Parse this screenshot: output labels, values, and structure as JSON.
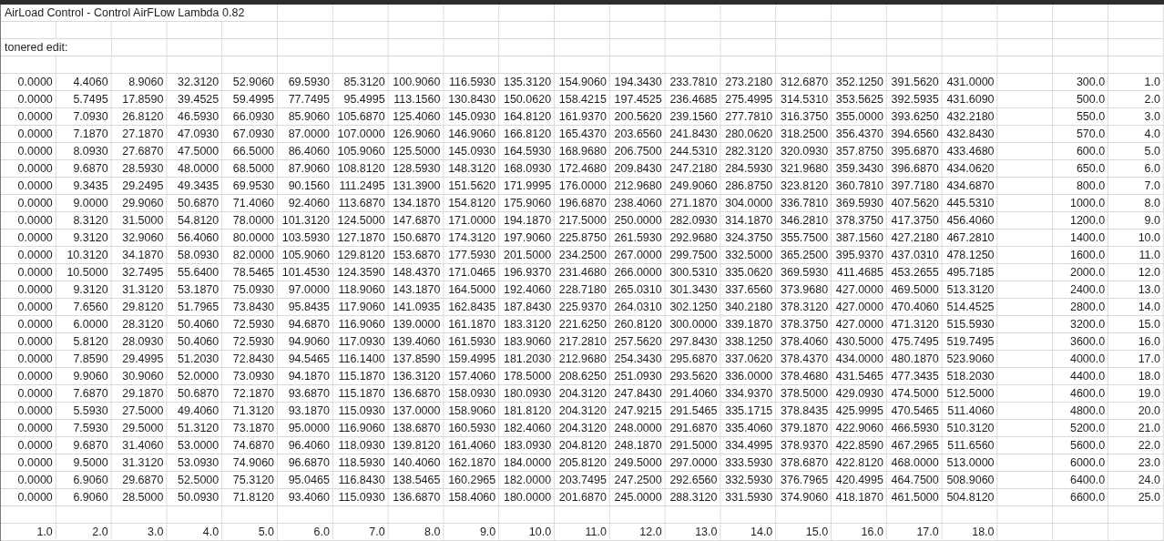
{
  "sheet": {
    "title": "AirLoad Control - Control AirFLow Lambda 0.82",
    "note": "tonered edit:",
    "rows": [
      {
        "values": [
          "0.0000",
          "4.4060",
          "8.9060",
          "32.3120",
          "52.9060",
          "69.5930",
          "85.3120",
          "100.9060",
          "116.5930",
          "135.3120",
          "154.9060",
          "194.3430",
          "233.7810",
          "273.2180",
          "312.6870",
          "352.1250",
          "391.5620",
          "431.0000"
        ],
        "rpm": "300.0",
        "index": "1.0"
      },
      {
        "values": [
          "0.0000",
          "5.7495",
          "17.8590",
          "39.4525",
          "59.4995",
          "77.7495",
          "95.4995",
          "113.1560",
          "130.8430",
          "150.0620",
          "158.4215",
          "197.4525",
          "236.4685",
          "275.4995",
          "314.5310",
          "353.5625",
          "392.5935",
          "431.6090"
        ],
        "rpm": "500.0",
        "index": "2.0"
      },
      {
        "values": [
          "0.0000",
          "7.0930",
          "26.8120",
          "46.5930",
          "66.0930",
          "85.9060",
          "105.6870",
          "125.4060",
          "145.0930",
          "164.8120",
          "161.9370",
          "200.5620",
          "239.1560",
          "277.7810",
          "316.3750",
          "355.0000",
          "393.6250",
          "432.2180"
        ],
        "rpm": "550.0",
        "index": "3.0"
      },
      {
        "values": [
          "0.0000",
          "7.1870",
          "27.1870",
          "47.0930",
          "67.0930",
          "87.0000",
          "107.0000",
          "126.9060",
          "146.9060",
          "166.8120",
          "165.4370",
          "203.6560",
          "241.8430",
          "280.0620",
          "318.2500",
          "356.4370",
          "394.6560",
          "432.8430"
        ],
        "rpm": "570.0",
        "index": "4.0"
      },
      {
        "values": [
          "0.0000",
          "8.0930",
          "27.6870",
          "47.5000",
          "66.5000",
          "86.4060",
          "105.9060",
          "125.5000",
          "145.0930",
          "164.5930",
          "168.9680",
          "206.7500",
          "244.5310",
          "282.3120",
          "320.0930",
          "357.8750",
          "395.6870",
          "433.4680"
        ],
        "rpm": "600.0",
        "index": "5.0"
      },
      {
        "values": [
          "0.0000",
          "9.6870",
          "28.5930",
          "48.0000",
          "68.5000",
          "87.9060",
          "108.8120",
          "128.5930",
          "148.3120",
          "168.0930",
          "172.4680",
          "209.8430",
          "247.2180",
          "284.5930",
          "321.9680",
          "359.3430",
          "396.6870",
          "434.0620"
        ],
        "rpm": "650.0",
        "index": "6.0"
      },
      {
        "values": [
          "0.0000",
          "9.3435",
          "29.2495",
          "49.3435",
          "69.9530",
          "90.1560",
          "111.2495",
          "131.3900",
          "151.5620",
          "171.9995",
          "176.0000",
          "212.9680",
          "249.9060",
          "286.8750",
          "323.8120",
          "360.7810",
          "397.7180",
          "434.6870"
        ],
        "rpm": "800.0",
        "index": "7.0"
      },
      {
        "values": [
          "0.0000",
          "9.0000",
          "29.9060",
          "50.6870",
          "71.4060",
          "92.4060",
          "113.6870",
          "134.1870",
          "154.8120",
          "175.9060",
          "196.6870",
          "238.4060",
          "271.1870",
          "304.0000",
          "336.7810",
          "369.5930",
          "407.5620",
          "445.5310"
        ],
        "rpm": "1000.0",
        "index": "8.0"
      },
      {
        "values": [
          "0.0000",
          "8.3120",
          "31.5000",
          "54.8120",
          "78.0000",
          "101.3120",
          "124.5000",
          "147.6870",
          "171.0000",
          "194.1870",
          "217.5000",
          "250.0000",
          "282.0930",
          "314.1870",
          "346.2810",
          "378.3750",
          "417.3750",
          "456.4060"
        ],
        "rpm": "1200.0",
        "index": "9.0"
      },
      {
        "values": [
          "0.0000",
          "9.3120",
          "32.9060",
          "56.4060",
          "80.0000",
          "103.5930",
          "127.1870",
          "150.6870",
          "174.3120",
          "197.9060",
          "225.8750",
          "261.5930",
          "292.9680",
          "324.3750",
          "355.7500",
          "387.1560",
          "427.2180",
          "467.2810"
        ],
        "rpm": "1400.0",
        "index": "10.0"
      },
      {
        "values": [
          "0.0000",
          "10.3120",
          "34.1870",
          "58.0930",
          "82.0000",
          "105.9060",
          "129.8120",
          "153.6870",
          "177.5930",
          "201.5000",
          "234.2500",
          "267.0000",
          "299.7500",
          "332.5000",
          "365.2500",
          "395.9370",
          "437.0310",
          "478.1250"
        ],
        "rpm": "1600.0",
        "index": "11.0"
      },
      {
        "values": [
          "0.0000",
          "10.5000",
          "32.7495",
          "55.6400",
          "78.5465",
          "101.4530",
          "124.3590",
          "148.4370",
          "171.0465",
          "196.9370",
          "231.4680",
          "266.0000",
          "300.5310",
          "335.0620",
          "369.5930",
          "411.4685",
          "453.2655",
          "495.7185"
        ],
        "rpm": "2000.0",
        "index": "12.0"
      },
      {
        "values": [
          "0.0000",
          "9.3120",
          "31.3120",
          "53.1870",
          "75.0930",
          "97.0000",
          "118.9060",
          "143.1870",
          "164.5000",
          "192.4060",
          "228.7180",
          "265.0310",
          "301.3430",
          "337.6560",
          "373.9680",
          "427.0000",
          "469.5000",
          "513.3120"
        ],
        "rpm": "2400.0",
        "index": "13.0"
      },
      {
        "values": [
          "0.0000",
          "7.6560",
          "29.8120",
          "51.7965",
          "73.8430",
          "95.8435",
          "117.9060",
          "141.0935",
          "162.8435",
          "187.8430",
          "225.9370",
          "264.0310",
          "302.1250",
          "340.2180",
          "378.3120",
          "427.0000",
          "470.4060",
          "514.4525"
        ],
        "rpm": "2800.0",
        "index": "14.0"
      },
      {
        "values": [
          "0.0000",
          "6.0000",
          "28.3120",
          "50.4060",
          "72.5930",
          "94.6870",
          "116.9060",
          "139.0000",
          "161.1870",
          "183.3120",
          "221.6250",
          "260.8120",
          "300.0000",
          "339.1870",
          "378.3750",
          "427.0000",
          "471.3120",
          "515.5930"
        ],
        "rpm": "3200.0",
        "index": "15.0"
      },
      {
        "values": [
          "0.0000",
          "5.8120",
          "28.0930",
          "50.4060",
          "72.5930",
          "94.9060",
          "117.0930",
          "139.4060",
          "161.5930",
          "183.9060",
          "217.2810",
          "257.5620",
          "297.8430",
          "338.1250",
          "378.4060",
          "430.5000",
          "475.7495",
          "519.7495"
        ],
        "rpm": "3600.0",
        "index": "16.0"
      },
      {
        "values": [
          "0.0000",
          "7.8590",
          "29.4995",
          "51.2030",
          "72.8430",
          "94.5465",
          "116.1400",
          "137.8590",
          "159.4995",
          "181.2030",
          "212.9680",
          "254.3430",
          "295.6870",
          "337.0620",
          "378.4370",
          "434.0000",
          "480.1870",
          "523.9060"
        ],
        "rpm": "4000.0",
        "index": "17.0"
      },
      {
        "values": [
          "0.0000",
          "9.9060",
          "30.9060",
          "52.0000",
          "73.0930",
          "94.1870",
          "115.1870",
          "136.3120",
          "157.4060",
          "178.5000",
          "208.6250",
          "251.0930",
          "293.5620",
          "336.0000",
          "378.4680",
          "431.5465",
          "477.3435",
          "518.2030"
        ],
        "rpm": "4400.0",
        "index": "18.0"
      },
      {
        "values": [
          "0.0000",
          "7.6870",
          "29.1870",
          "50.6870",
          "72.1870",
          "93.6870",
          "115.1870",
          "136.6870",
          "158.0930",
          "180.0930",
          "204.3120",
          "247.8430",
          "291.4060",
          "334.9370",
          "378.5000",
          "429.0930",
          "474.5000",
          "512.5000"
        ],
        "rpm": "4600.0",
        "index": "19.0"
      },
      {
        "values": [
          "0.0000",
          "5.5930",
          "27.5000",
          "49.4060",
          "71.3120",
          "93.1870",
          "115.0930",
          "137.0000",
          "158.9060",
          "181.8120",
          "204.3120",
          "247.9215",
          "291.5465",
          "335.1715",
          "378.8435",
          "425.9995",
          "470.5465",
          "511.4060"
        ],
        "rpm": "4800.0",
        "index": "20.0"
      },
      {
        "values": [
          "0.0000",
          "7.5930",
          "29.5000",
          "51.3120",
          "73.1870",
          "95.0000",
          "116.9060",
          "138.6870",
          "160.5930",
          "182.4060",
          "204.3120",
          "248.0000",
          "291.6870",
          "335.4060",
          "379.1870",
          "422.9060",
          "466.5930",
          "510.3120"
        ],
        "rpm": "5200.0",
        "index": "21.0"
      },
      {
        "values": [
          "0.0000",
          "9.6870",
          "31.4060",
          "53.0000",
          "74.6870",
          "96.4060",
          "118.0930",
          "139.8120",
          "161.4060",
          "183.0930",
          "204.8120",
          "248.1870",
          "291.5000",
          "334.4995",
          "378.9370",
          "422.8590",
          "467.2965",
          "511.6560"
        ],
        "rpm": "5600.0",
        "index": "22.0"
      },
      {
        "values": [
          "0.0000",
          "9.5000",
          "31.3120",
          "53.0930",
          "74.9060",
          "96.6870",
          "118.5930",
          "140.4060",
          "162.1870",
          "184.0000",
          "205.8120",
          "249.5000",
          "297.0000",
          "333.5930",
          "378.6870",
          "422.8120",
          "468.0000",
          "513.0000"
        ],
        "rpm": "6000.0",
        "index": "23.0"
      },
      {
        "values": [
          "0.0000",
          "6.9060",
          "29.6870",
          "52.5000",
          "75.3120",
          "95.0465",
          "116.8430",
          "138.5465",
          "160.2965",
          "182.0000",
          "203.7495",
          "247.2500",
          "292.6560",
          "332.5930",
          "376.7965",
          "420.4995",
          "464.7500",
          "508.9060"
        ],
        "rpm": "6400.0",
        "index": "24.0"
      },
      {
        "values": [
          "0.0000",
          "6.9060",
          "28.5000",
          "50.0930",
          "71.8120",
          "93.4060",
          "115.0930",
          "136.6870",
          "158.4060",
          "180.0000",
          "201.6870",
          "245.0000",
          "288.3120",
          "331.5930",
          "374.9060",
          "418.1870",
          "461.5000",
          "504.8120"
        ],
        "rpm": "6600.0",
        "index": "25.0"
      }
    ],
    "footer": [
      "1.0",
      "2.0",
      "3.0",
      "4.0",
      "5.0",
      "6.0",
      "7.0",
      "8.0",
      "9.0",
      "10.0",
      "11.0",
      "12.0",
      "13.0",
      "14.0",
      "15.0",
      "16.0",
      "17.0",
      "18.0"
    ]
  }
}
